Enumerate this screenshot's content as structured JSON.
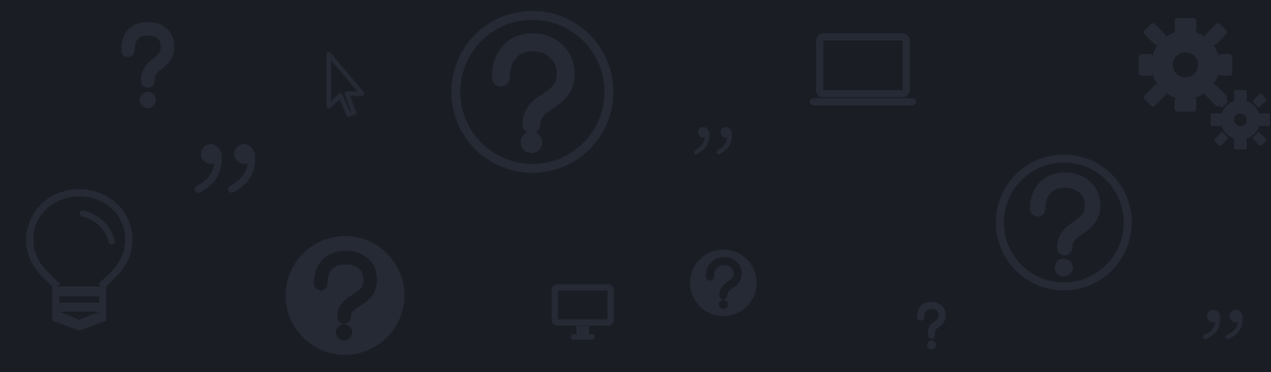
{
  "theme": {
    "background": "#1b1d25",
    "icon_color": "#262a34"
  },
  "decorations": [
    "question-mark-icon",
    "mouse-pointer-icon",
    "question-circle-outline-icon",
    "closing-quote-icon",
    "laptop-icon",
    "gears-icon",
    "lightbulb-icon",
    "question-circle-solid-icon",
    "desktop-monitor-icon"
  ]
}
